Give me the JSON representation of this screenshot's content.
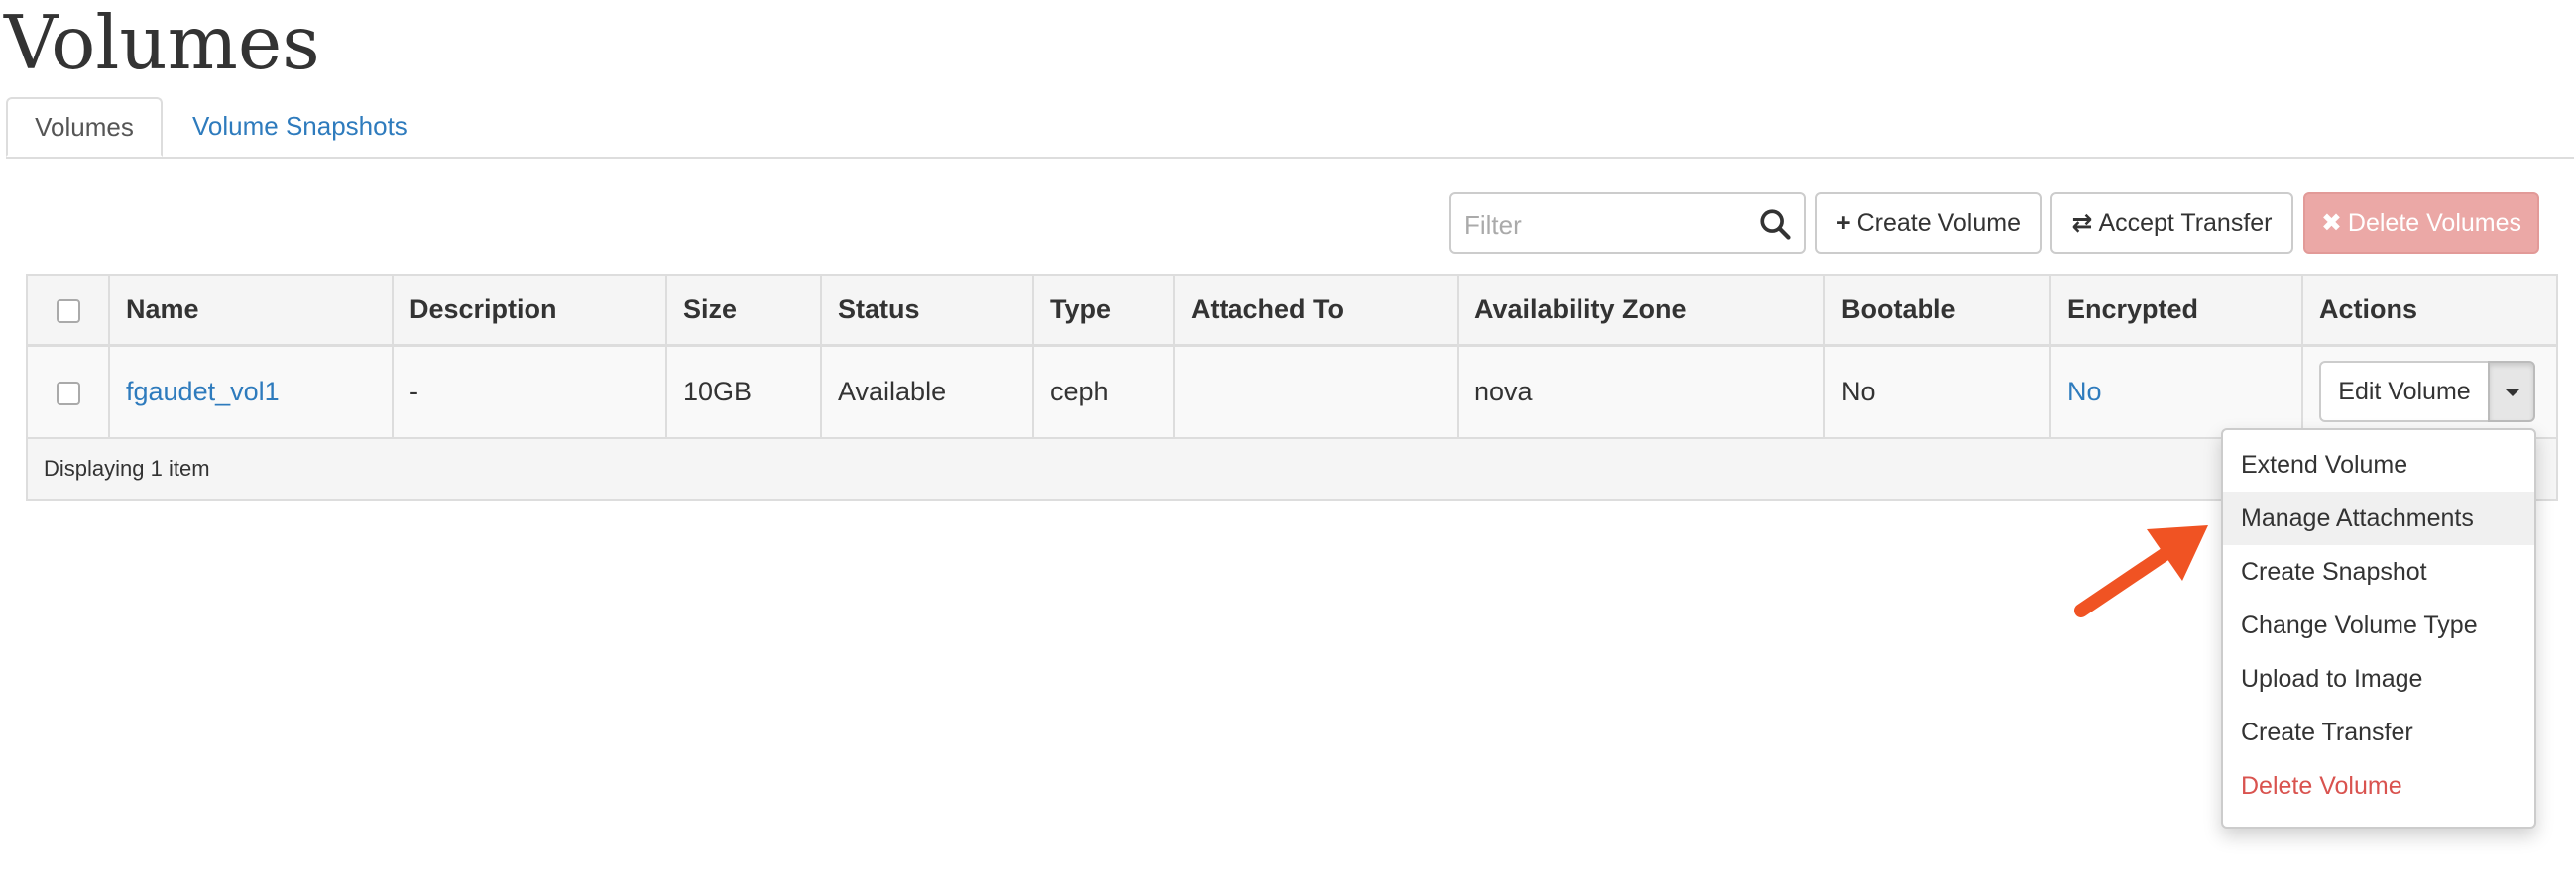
{
  "page": {
    "title": "Volumes"
  },
  "tabs": [
    {
      "label": "Volumes",
      "active": true
    },
    {
      "label": "Volume Snapshots",
      "active": false
    }
  ],
  "toolbar": {
    "filter_placeholder": "Filter",
    "search_icon": "search-icon",
    "create_label": "Create Volume",
    "create_icon": "+",
    "accept_label": "Accept Transfer",
    "accept_icon": "⇄",
    "delete_label": "Delete Volumes",
    "delete_icon": "✖",
    "delete_color": "#eba8a6"
  },
  "table": {
    "columns": [
      "Name",
      "Description",
      "Size",
      "Status",
      "Type",
      "Attached To",
      "Availability Zone",
      "Bootable",
      "Encrypted",
      "Actions"
    ],
    "rows": [
      {
        "name": "fgaudet_vol1",
        "description": "-",
        "size": "10GB",
        "status": "Available",
        "type": "ceph",
        "attached_to": "",
        "availability_zone": "nova",
        "bootable": "No",
        "encrypted": "No",
        "action_label": "Edit Volume"
      }
    ],
    "footer": "Displaying 1 item"
  },
  "dropdown": {
    "items": [
      {
        "label": "Extend Volume"
      },
      {
        "label": "Manage Attachments",
        "highlighted": true
      },
      {
        "label": "Create Snapshot"
      },
      {
        "label": "Change Volume Type"
      },
      {
        "label": "Upload to Image"
      },
      {
        "label": "Create Transfer"
      },
      {
        "label": "Delete Volume",
        "danger": true
      }
    ]
  },
  "annotation": {
    "arrow_color": "#f05323"
  },
  "colors": {
    "link": "#2e7bbd",
    "danger": "#d9534f"
  }
}
